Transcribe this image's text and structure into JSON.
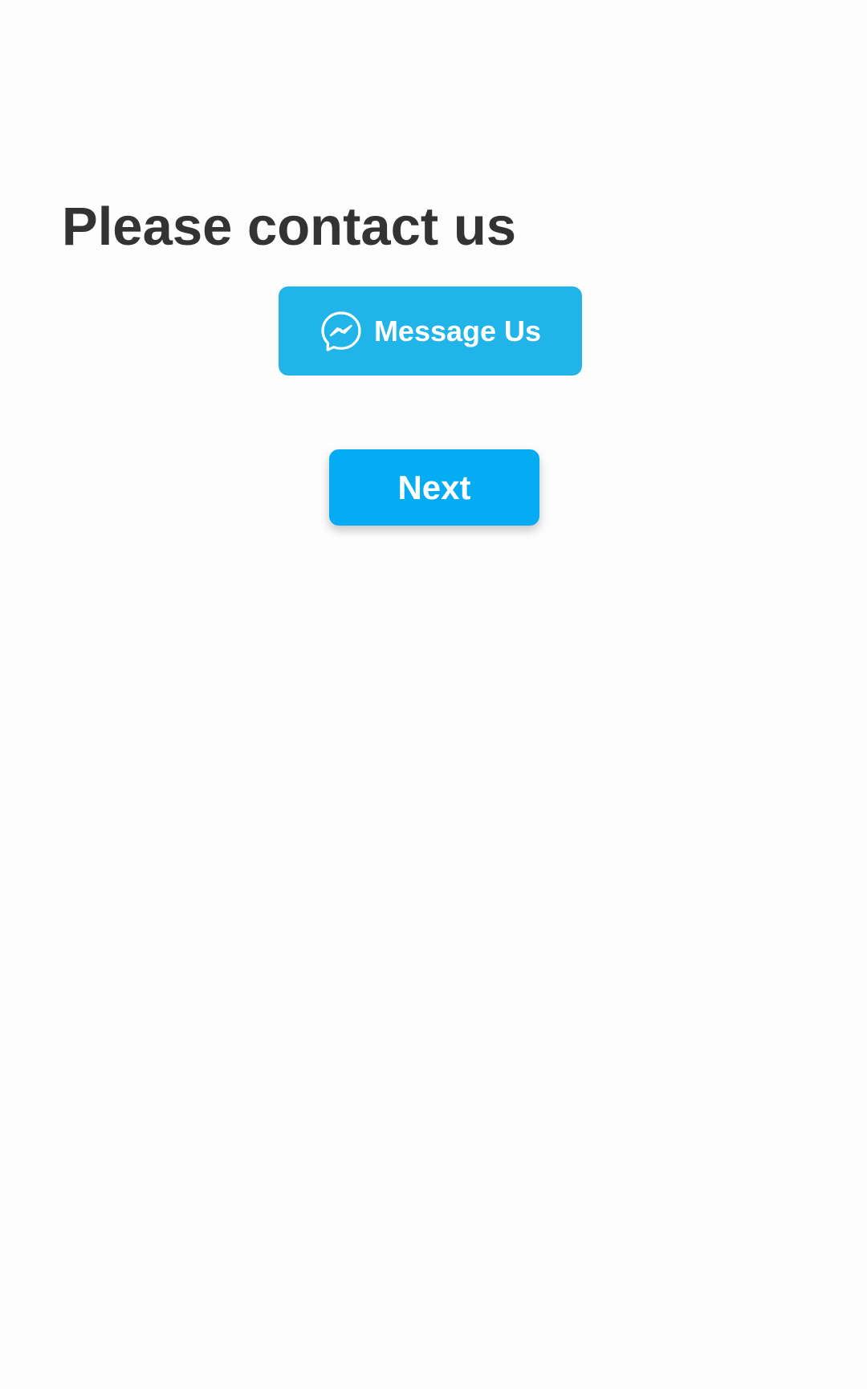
{
  "page": {
    "title": "Please contact us"
  },
  "message_button": {
    "label": "Message Us",
    "icon": "messenger-icon",
    "color": "#21b4e8"
  },
  "next_button": {
    "label": "Next",
    "color": "#05acf4"
  },
  "colors": {
    "background": "#fdfdfd",
    "title_text": "#333333",
    "button_text": "#ffffff"
  }
}
